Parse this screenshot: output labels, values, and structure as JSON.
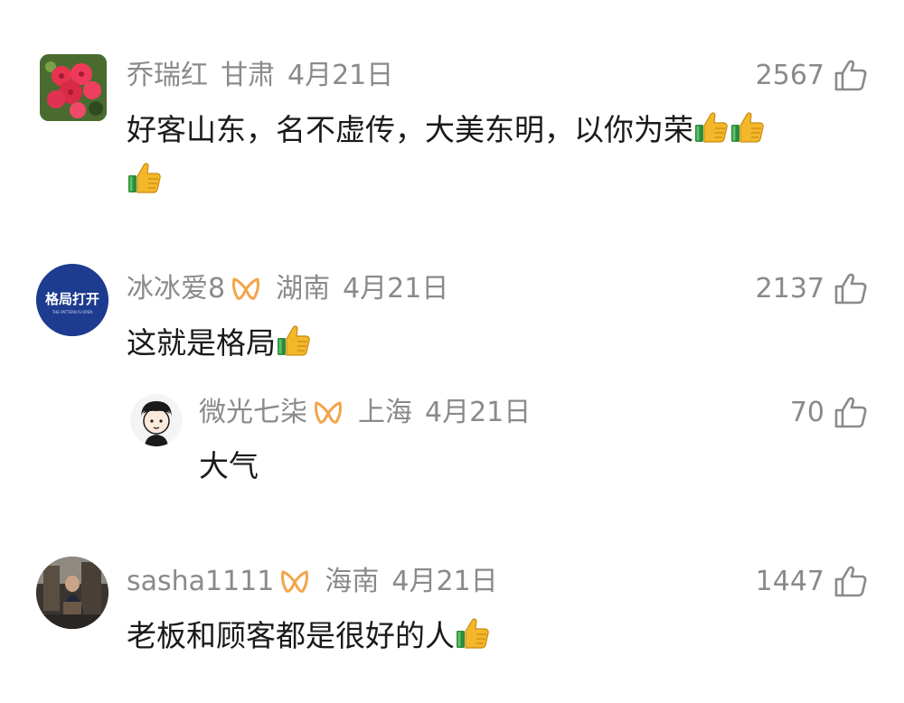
{
  "comments": [
    {
      "user": "乔瑞红",
      "region": "甘肃",
      "date": "4月21日",
      "likes": "2567",
      "text": "好客山东，名不虚传，大美东明，以你为荣",
      "emoji_count": 3,
      "verified": false,
      "avatar": "red-flowers-avatar"
    },
    {
      "user": "冰冰爱8",
      "region": "湖南",
      "date": "4月21日",
      "likes": "2137",
      "text": "这就是格局",
      "emoji_count": 1,
      "verified": true,
      "avatar_text": "格局打开",
      "avatar_subtext": "THE PATTERN IS OPEN",
      "replies": [
        {
          "user": "微光七柒",
          "region": "上海",
          "date": "4月21日",
          "likes": "70",
          "text": "大气",
          "verified": true,
          "avatar": "cartoon-boy-avatar"
        }
      ]
    },
    {
      "user": "sasha1111",
      "region": "海南",
      "date": "4月21日",
      "likes": "1447",
      "text": "老板和顾客都是很好的人",
      "emoji_count": 1,
      "verified": true,
      "avatar": "photo-avatar"
    }
  ],
  "colors": {
    "meta_text": "#8a8a8a",
    "body_text": "#1a1a1a",
    "vip_badge": "#f2a54a",
    "avatar_blue": "#1d3b8f",
    "flower_red": "#e8334f"
  }
}
